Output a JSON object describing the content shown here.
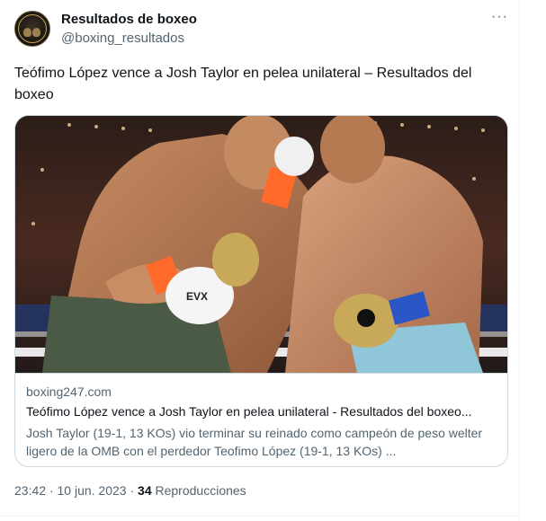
{
  "author": {
    "display_name": "Resultados de boxeo",
    "handle": "@boxing_resultados",
    "avatar_icon": "boxing-gloves-logo"
  },
  "more_icon": "more-options-icon",
  "tweet": {
    "text": "Teófimo López vence a Josh Taylor en pelea unilateral – Resultados del boxeo"
  },
  "card": {
    "domain": "boxing247.com",
    "title": "Teófimo López vence a Josh Taylor en pelea unilateral - Resultados del boxeo...",
    "description": "Josh Taylor (19-1, 13 KOs) vio terminar su reinado como campeón de peso welter ligero de la OMB con el perdedor Teofimo López (19-1, 13 KOs) ...",
    "image_alt": "boxing match photo"
  },
  "meta": {
    "time": "23:42",
    "date": "10 jun. 2023",
    "views_count": "34",
    "views_label": "Reproducciones"
  },
  "colors": {
    "text_primary": "#0f1419",
    "text_secondary": "#536471",
    "border": "#cfd9de"
  }
}
